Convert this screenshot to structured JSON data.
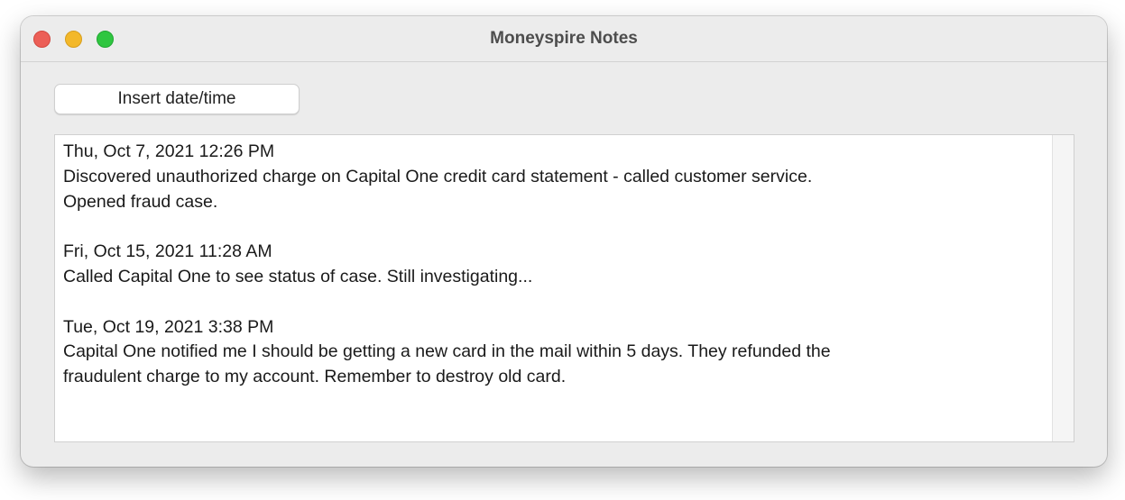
{
  "window": {
    "title": "Moneyspire Notes"
  },
  "toolbar": {
    "insert_datetime_label": "Insert date/time"
  },
  "notes": {
    "entries": [
      {
        "timestamp": "Thu, Oct 7, 2021 12:26 PM",
        "lines": [
          "Discovered unauthorized charge on Capital One credit card statement - called customer service.",
          "Opened fraud case."
        ]
      },
      {
        "timestamp": "Fri, Oct 15, 2021 11:28 AM",
        "lines": [
          "Called Capital One to see status of case. Still investigating..."
        ]
      },
      {
        "timestamp": "Tue, Oct 19, 2021 3:38 PM",
        "lines": [
          "Capital One notified me I should be getting a new card in the mail within 5 days. They refunded the",
          "fraudulent charge to my account. Remember to destroy old card."
        ]
      }
    ]
  },
  "colors": {
    "close": "#ec5f57",
    "minimize": "#f3b82a",
    "zoom": "#2fc640",
    "window_bg": "#ececec",
    "text": "#1a1a1a"
  }
}
